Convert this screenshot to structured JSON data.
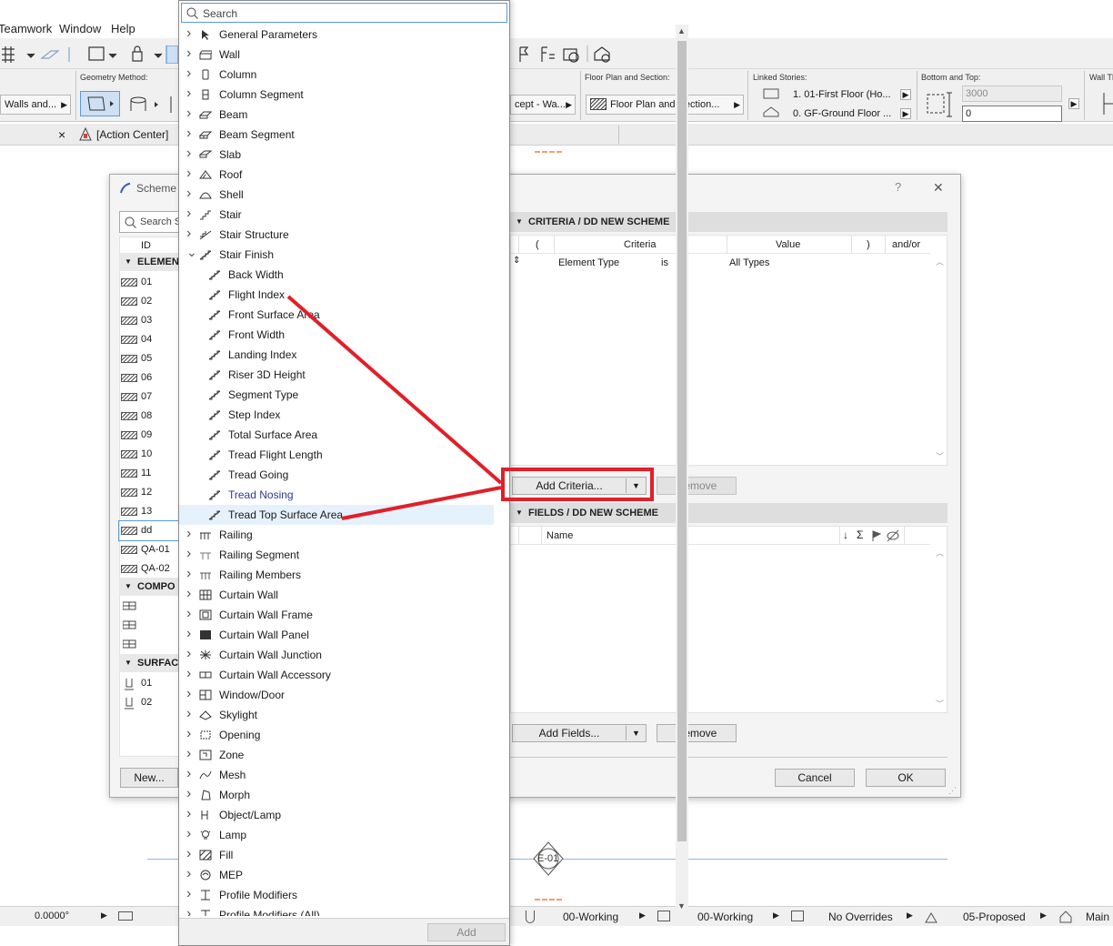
{
  "menubar": {
    "items": [
      "Teamwork",
      "Window",
      "Help"
    ]
  },
  "infobox": {
    "geometry_method_label": "Geometry Method:",
    "walls_btn": "Walls and...",
    "floor_plan_label": "Floor Plan and Section:",
    "floor_plan_value": "Floor Plan and Section...",
    "concept_value": "cept - Wa...",
    "linked_stories_label": "Linked Stories:",
    "story_top": "1. 01-First Floor (Ho...",
    "story_bottom": "0. GF-Ground Floor ...",
    "bottom_top_label": "Bottom and Top:",
    "top_value": "3000",
    "bottom_value": "0",
    "wall_label": "Wall Th"
  },
  "tabbar": {
    "close": "×",
    "tab_label": "[Action Center]"
  },
  "canvas": {
    "marker_label": "E-01"
  },
  "statusbar": {
    "angle": "0.0000°",
    "layer1": "00-Working",
    "layer2": "00-Working",
    "overrides": "No Overrides",
    "renovation": "05-Proposed",
    "structure": "Main"
  },
  "scheme_dialog": {
    "title": "Scheme",
    "help": "?",
    "close": "✕",
    "search_placeholder": "Search S",
    "id_header": "ID",
    "groups": {
      "elements": "ELEMEN",
      "components": "COMPO",
      "surfaces": "SURFAC"
    },
    "element_ids": [
      "01",
      "02",
      "03",
      "04",
      "05",
      "06",
      "07",
      "08",
      "09",
      "10",
      "11",
      "12",
      "13",
      "dd",
      "QA-01",
      "QA-02"
    ],
    "surface_ids": [
      "01",
      "02"
    ],
    "new_button": "New...",
    "criteria_header": "CRITERIA / DD NEW SCHEME",
    "criteria_cols": {
      "open": "(",
      "criteria": "Criteria",
      "value": "Value",
      "close": ")",
      "andor": "and/or"
    },
    "criteria_row": {
      "criteria": "Element Type",
      "op": "is",
      "value": "All Types"
    },
    "add_criteria": "Add Criteria...",
    "remove": "Remove",
    "fields_header": "FIELDS / DD NEW SCHEME",
    "fields_name_col": "Name",
    "fields_icons": [
      "↓",
      "Σ"
    ],
    "add_fields": "Add Fields...",
    "cancel": "Cancel",
    "ok": "OK"
  },
  "popup": {
    "search_placeholder": "Search",
    "add_button": "Add",
    "items": [
      {
        "label": "General Parameters",
        "icon": "arrow-icon"
      },
      {
        "label": "Wall",
        "icon": "wall-icon"
      },
      {
        "label": "Column",
        "icon": "column-icon"
      },
      {
        "label": "Column Segment",
        "icon": "column-segment-icon"
      },
      {
        "label": "Beam",
        "icon": "beam-icon"
      },
      {
        "label": "Beam Segment",
        "icon": "beam-segment-icon"
      },
      {
        "label": "Slab",
        "icon": "slab-icon"
      },
      {
        "label": "Roof",
        "icon": "roof-icon"
      },
      {
        "label": "Shell",
        "icon": "shell-icon"
      },
      {
        "label": "Stair",
        "icon": "stair-icon"
      },
      {
        "label": "Stair Structure",
        "icon": "stair-structure-icon"
      },
      {
        "label": "Stair Finish",
        "icon": "stair-finish-icon",
        "expanded": true
      },
      {
        "label": "Back Width",
        "icon": "stair-finish-icon",
        "child": true
      },
      {
        "label": "Flight Index",
        "icon": "stair-finish-icon",
        "child": true
      },
      {
        "label": "Front Surface Area",
        "icon": "stair-finish-icon",
        "child": true
      },
      {
        "label": "Front Width",
        "icon": "stair-finish-icon",
        "child": true
      },
      {
        "label": "Landing Index",
        "icon": "stair-finish-icon",
        "child": true
      },
      {
        "label": "Riser 3D Height",
        "icon": "stair-finish-icon",
        "child": true
      },
      {
        "label": "Segment Type",
        "icon": "stair-finish-icon",
        "child": true
      },
      {
        "label": "Step Index",
        "icon": "stair-finish-icon",
        "child": true
      },
      {
        "label": "Total Surface Area",
        "icon": "stair-finish-icon",
        "child": true
      },
      {
        "label": "Tread Flight Length",
        "icon": "stair-finish-icon",
        "child": true
      },
      {
        "label": "Tread Going",
        "icon": "stair-finish-icon",
        "child": true
      },
      {
        "label": "Tread Nosing",
        "icon": "stair-finish-icon",
        "child": true,
        "hover": true
      },
      {
        "label": "Tread Top Surface Area",
        "icon": "stair-finish-icon",
        "child": true,
        "selected": true
      },
      {
        "label": "Railing",
        "icon": "railing-icon"
      },
      {
        "label": "Railing Segment",
        "icon": "railing-segment-icon"
      },
      {
        "label": "Railing Members",
        "icon": "railing-members-icon"
      },
      {
        "label": "Curtain Wall",
        "icon": "curtain-wall-icon"
      },
      {
        "label": "Curtain Wall Frame",
        "icon": "curtain-wall-frame-icon"
      },
      {
        "label": "Curtain Wall Panel",
        "icon": "curtain-wall-panel-icon"
      },
      {
        "label": "Curtain Wall Junction",
        "icon": "curtain-wall-junction-icon"
      },
      {
        "label": "Curtain Wall Accessory",
        "icon": "curtain-wall-accessory-icon"
      },
      {
        "label": "Window/Door",
        "icon": "window-door-icon"
      },
      {
        "label": "Skylight",
        "icon": "skylight-icon"
      },
      {
        "label": "Opening",
        "icon": "opening-icon"
      },
      {
        "label": "Zone",
        "icon": "zone-icon"
      },
      {
        "label": "Mesh",
        "icon": "mesh-icon"
      },
      {
        "label": "Morph",
        "icon": "morph-icon"
      },
      {
        "label": "Object/Lamp",
        "icon": "object-icon"
      },
      {
        "label": "Lamp",
        "icon": "lamp-icon"
      },
      {
        "label": "Fill",
        "icon": "fill-icon"
      },
      {
        "label": "MEP",
        "icon": "mep-icon"
      },
      {
        "label": "Profile Modifiers",
        "icon": "profile-modifiers-icon"
      },
      {
        "label": "Profile Modifiers (All)",
        "icon": "profile-modifiers-icon"
      }
    ]
  },
  "colors": {
    "annotation_red": "#e0202a",
    "selection_blue": "#e5f1fb",
    "link_blue": "#2b3a8f"
  }
}
